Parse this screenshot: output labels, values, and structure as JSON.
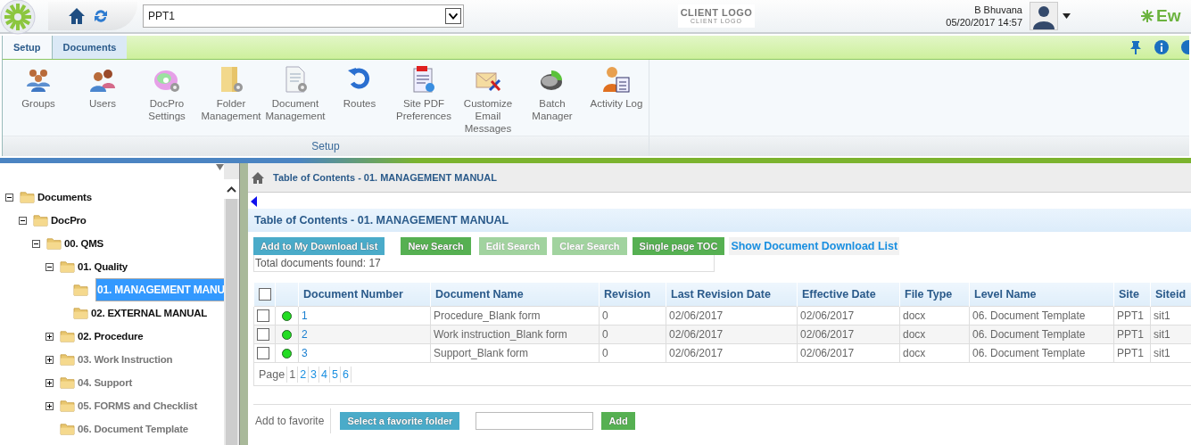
{
  "topbar": {
    "site_select": {
      "value": "PPT1"
    },
    "client_logo": "CLIENT LOGO",
    "client_logo_tagline": "CLIENT LOGO",
    "user_name": "B Bhuvana",
    "datetime": "05/20/2017 14:57",
    "brand": "Ew"
  },
  "ribbon": {
    "tabs": [
      {
        "label": "Setup",
        "selected": true
      },
      {
        "label": "Documents",
        "selected": false
      }
    ],
    "items": [
      {
        "label": "Groups"
      },
      {
        "label": "Users"
      },
      {
        "label": "DocPro\nSettings"
      },
      {
        "label": "Folder\nManagement"
      },
      {
        "label": "Document\nManagement"
      },
      {
        "label": "Routes"
      },
      {
        "label": "Site PDF\nPreferences"
      },
      {
        "label": "Customize\nEmail\nMessages"
      },
      {
        "label": "Batch\nManager"
      },
      {
        "label": "Activity Log"
      }
    ],
    "group_label": "Setup"
  },
  "tree": [
    {
      "label": "Documents",
      "expanded": true,
      "selected": false,
      "disabled": false,
      "children": [
        {
          "label": "DocPro",
          "expanded": true,
          "selected": false,
          "disabled": false,
          "children": [
            {
              "label": "00. QMS",
              "expanded": true,
              "selected": false,
              "disabled": false,
              "children": [
                {
                  "label": "01. Quality",
                  "expanded": true,
                  "selected": false,
                  "disabled": false,
                  "children": [
                    {
                      "label": "01. MANAGEMENT MANU",
                      "selected": true,
                      "disabled": false
                    },
                    {
                      "label": "02. EXTERNAL MANUAL",
                      "selected": false,
                      "disabled": false
                    }
                  ]
                },
                {
                  "label": "02. Procedure",
                  "expanded": false,
                  "selected": false,
                  "disabled": false
                },
                {
                  "label": "03. Work Instruction",
                  "expanded": false,
                  "selected": false,
                  "disabled": true
                },
                {
                  "label": "04. Support",
                  "expanded": false,
                  "selected": false,
                  "disabled": true
                },
                {
                  "label": "05. FORMS and Checklist",
                  "expanded": false,
                  "selected": false,
                  "disabled": true
                },
                {
                  "label": "06. Document Template",
                  "selected": false,
                  "disabled": true
                }
              ]
            }
          ]
        }
      ]
    }
  ],
  "breadcrumb": "Table of Contents - 01. MANAGEMENT MANUAL",
  "title": "Table of Contents - 01. MANAGEMENT MANUAL",
  "actions": [
    {
      "label": "Add to My Download List",
      "kind": "blue",
      "disabled": false
    },
    {
      "label": "New Search",
      "kind": "green",
      "disabled": false
    },
    {
      "label": "Edit Search",
      "kind": "green",
      "disabled": true
    },
    {
      "label": "Clear Search",
      "kind": "green",
      "disabled": true
    },
    {
      "label": "Single page TOC",
      "kind": "green",
      "disabled": false
    }
  ],
  "download_link": "Show Document Download List",
  "total": "Total documents found: 17",
  "table": {
    "select_all_checked": false,
    "columns": [
      "Document Number",
      "Document Name",
      "Revision",
      "Last Revision Date",
      "Effective Date",
      "File Type",
      "Level Name",
      "Site",
      "Siteid"
    ],
    "rows": [
      {
        "checked": false,
        "color": "#22dd22",
        "cells": [
          "1",
          "Procedure_Blank form",
          "0",
          "02/06/2017",
          "02/06/2017",
          "docx",
          "06. Document Template",
          "PPT1",
          "sit1"
        ]
      },
      {
        "checked": false,
        "color": "#22dd22",
        "cells": [
          "2",
          "Work instruction_Blank form",
          "0",
          "02/06/2017",
          "02/06/2017",
          "docx",
          "06. Document Template",
          "PPT1",
          "sit1"
        ]
      },
      {
        "checked": false,
        "color": "#22dd22",
        "cells": [
          "3",
          "Support_Blank form",
          "0",
          "02/06/2017",
          "02/06/2017",
          "docx",
          "06. Document Template",
          "PPT1",
          "sit1"
        ]
      }
    ]
  },
  "pager": {
    "label": "Page",
    "pages": [
      {
        "label": "1",
        "selected": true
      },
      {
        "label": "2",
        "selected": false
      },
      {
        "label": "3",
        "selected": false
      },
      {
        "label": "4",
        "selected": false
      },
      {
        "label": "5",
        "selected": false
      },
      {
        "label": "6",
        "selected": false
      }
    ]
  },
  "favorite": {
    "label": "Add to favorite",
    "select_button": "Select a favorite folder",
    "add_button": "Add"
  }
}
